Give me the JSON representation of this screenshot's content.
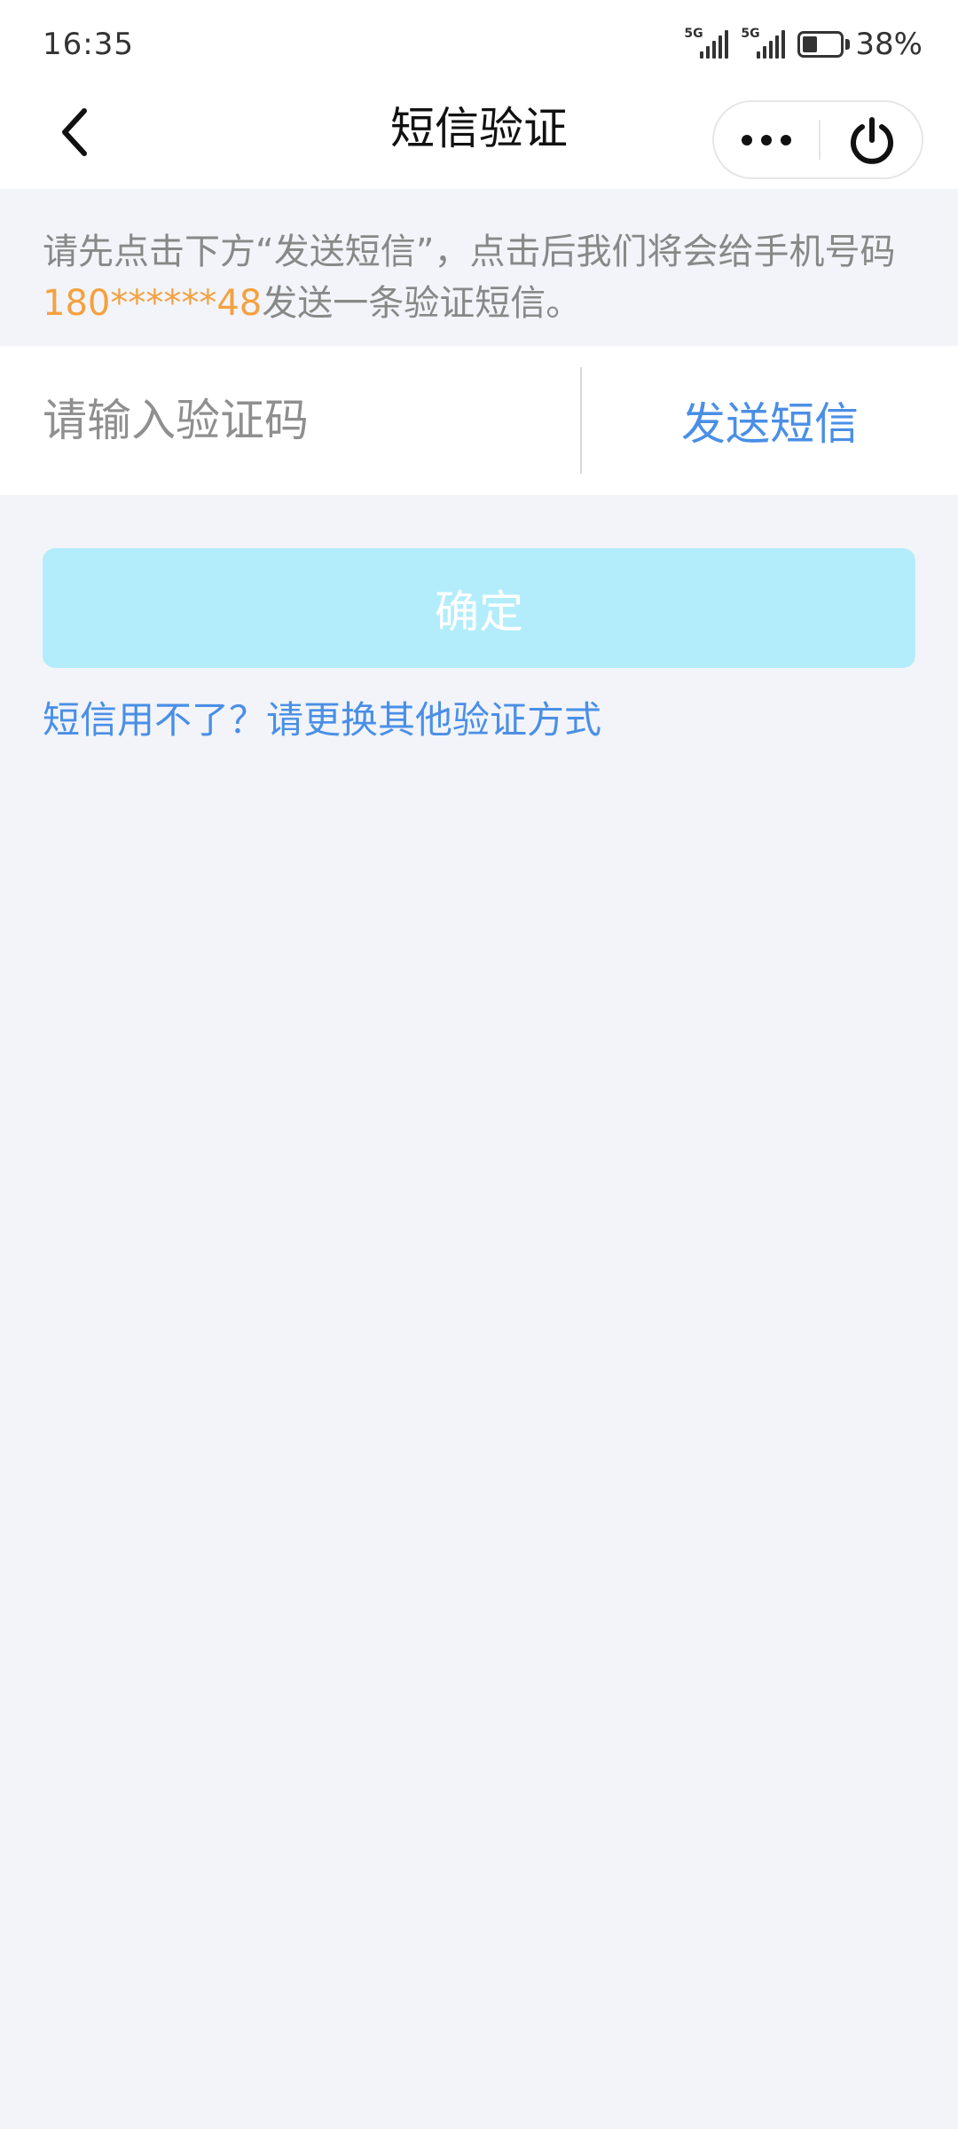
{
  "status_bar": {
    "time": "16:35",
    "signal_1_tag": "5G",
    "signal_2_tag": "5G",
    "battery_level": 0.38,
    "battery_text": "38%"
  },
  "nav": {
    "back_icon": "chevron-left-icon",
    "title": "短信验证",
    "more_icon": "more-dots-icon",
    "power_icon": "power-icon"
  },
  "info": {
    "text_before": "请先点击下方“发送短信”，点击后我们将会给手机号码",
    "phone": "180******48",
    "text_after": "发送一条验证短信。"
  },
  "form": {
    "code_placeholder": "请输入验证码",
    "code_value": "",
    "send_label": "发送短信"
  },
  "actions": {
    "confirm_label": "确定",
    "alt_link": "短信用不了？请更换其他验证方式"
  },
  "colors": {
    "accent": "#4a8fe6",
    "phone_highlight": "#f4a13f",
    "confirm_disabled": "#b3edfc",
    "page_bg": "#f2f4f9"
  }
}
